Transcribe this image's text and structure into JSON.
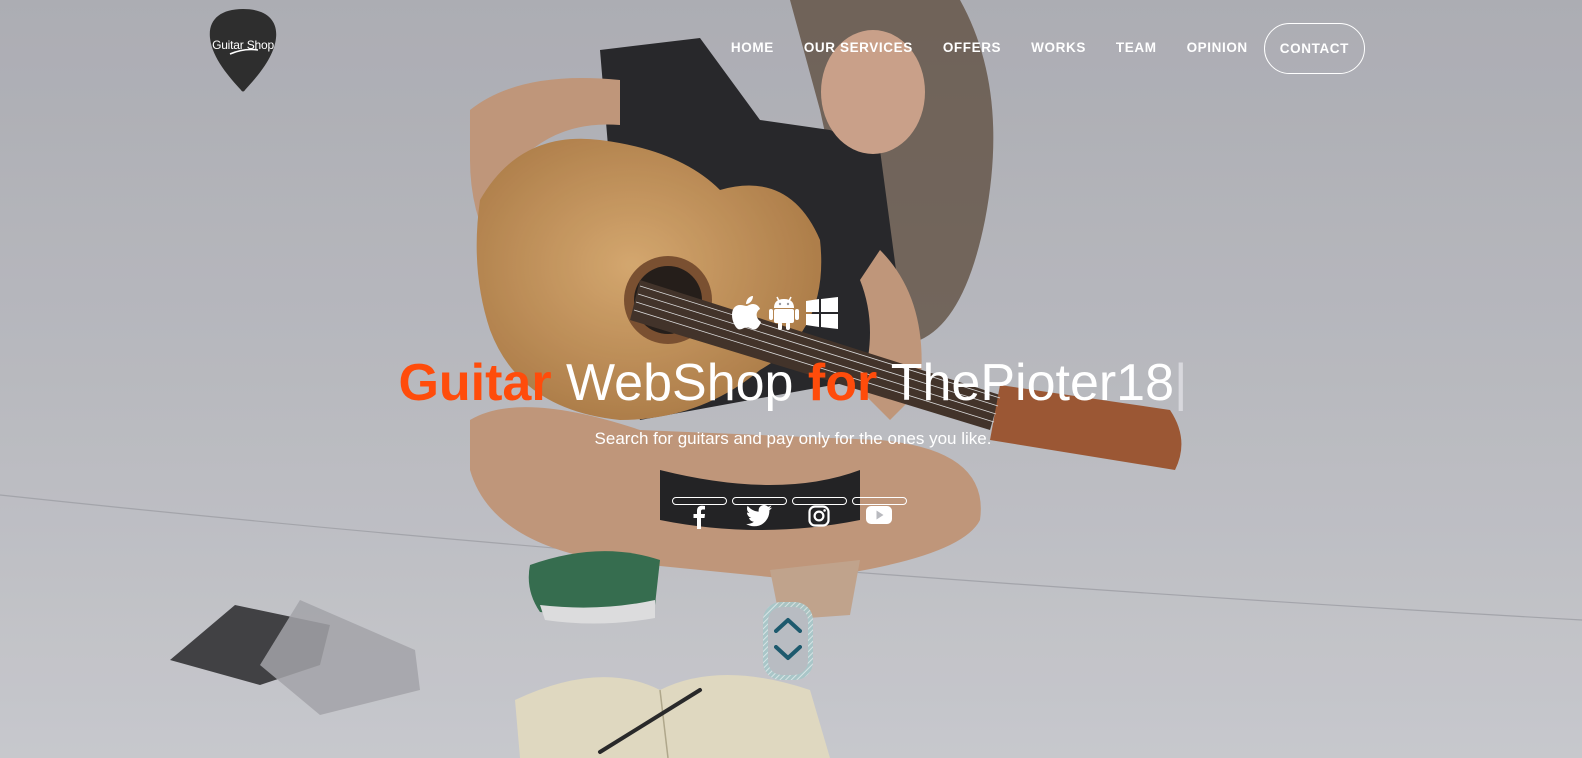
{
  "brand": {
    "logo_text": "Guitar Shop",
    "logo_color": "#2e2e2e"
  },
  "nav": {
    "items": [
      "HOME",
      "OUR SERVICES",
      "OFFERS",
      "WORKS",
      "TEAM",
      "OPINION"
    ],
    "contact_label": "CONTACT"
  },
  "platforms": [
    "apple-icon",
    "android-icon",
    "windows-icon"
  ],
  "hero": {
    "word_guitar": "Guitar",
    "word_webshop": " WebShop ",
    "word_for": "for",
    "word_name": " ThePioter18",
    "cursor": "|",
    "tagline": "Search for guitars and pay only for the ones you like."
  },
  "social": [
    "facebook-icon",
    "twitter-icon",
    "instagram-icon",
    "youtube-icon"
  ],
  "colors": {
    "accent": "#ff4c0b",
    "text": "#ffffff",
    "scroll_arrows": "#1d5a6e"
  }
}
